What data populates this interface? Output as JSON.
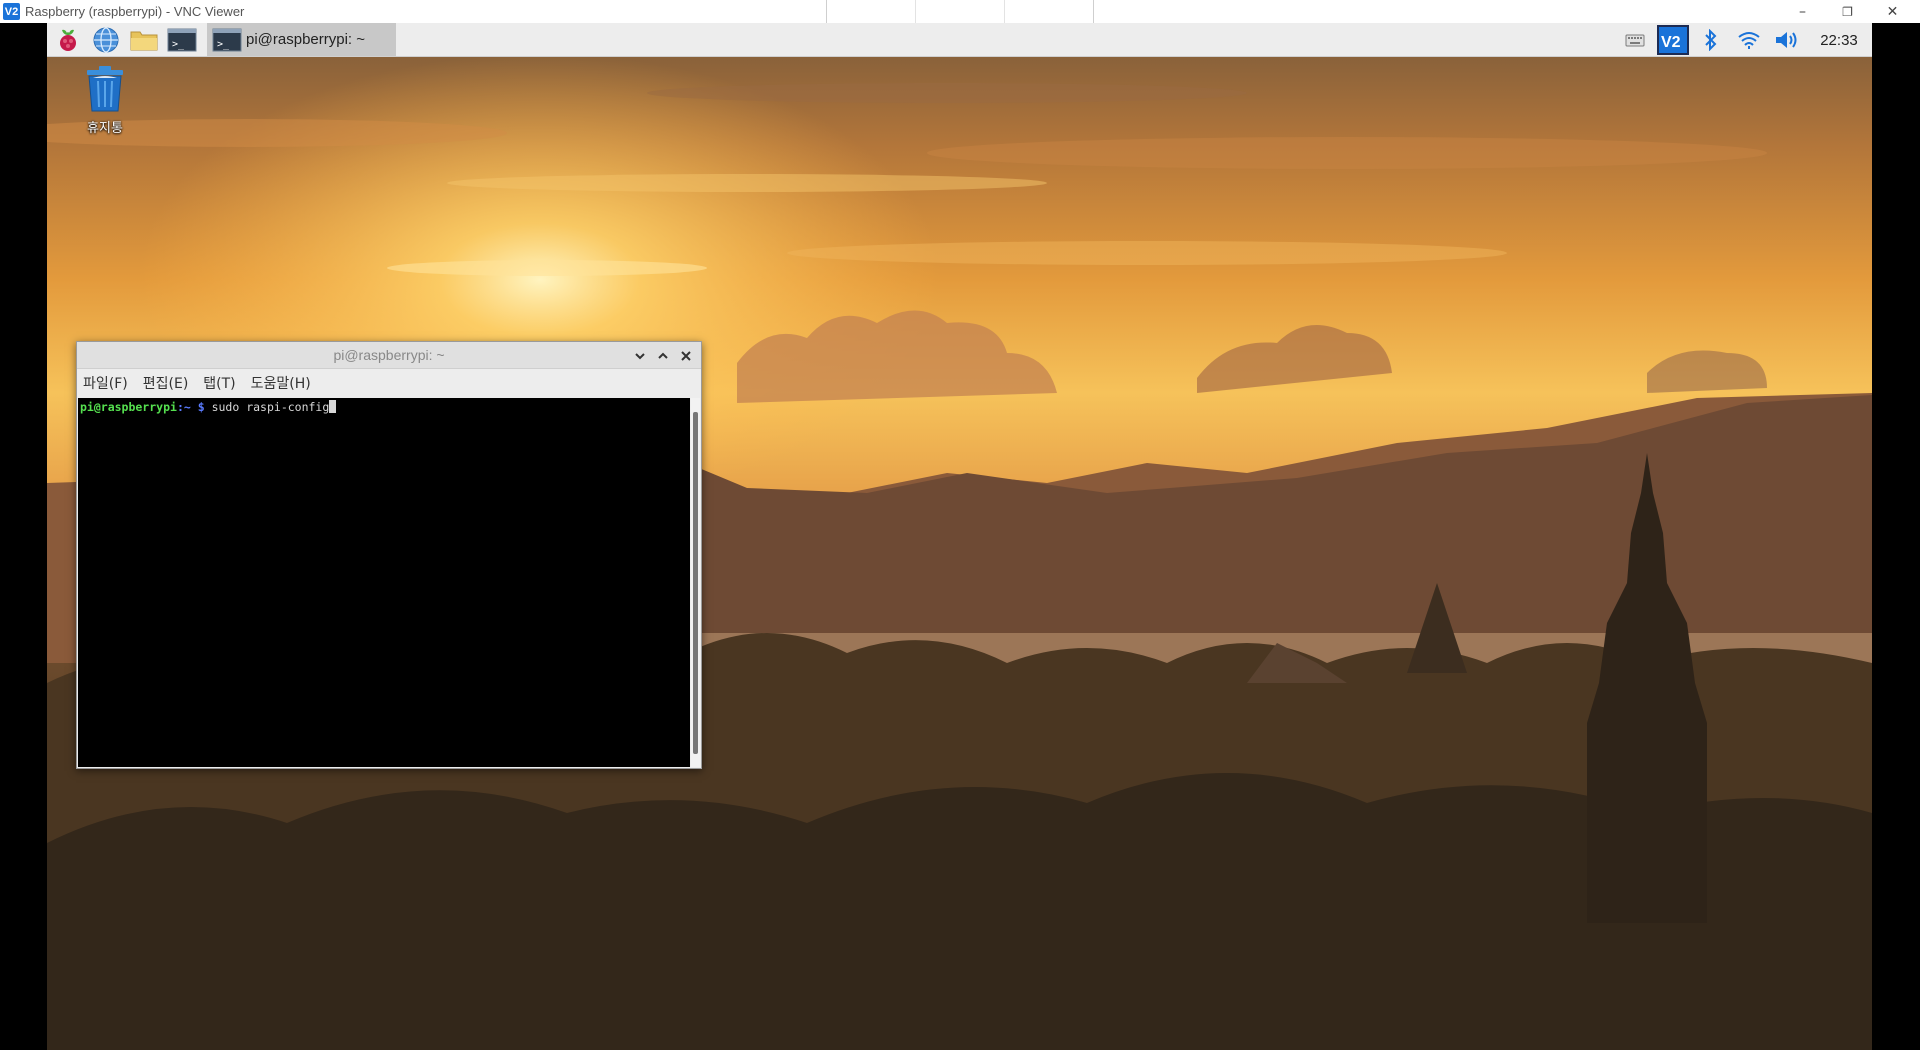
{
  "host": {
    "logo_text": "V2",
    "title": "Raspberry (raspberrypi) - VNC Viewer",
    "minimize": "–",
    "restore": "❐",
    "close": "✕"
  },
  "panel": {
    "launchers": [
      "raspberry-menu-icon",
      "web-browser-icon",
      "file-manager-icon",
      "terminal-icon"
    ],
    "task": {
      "label": "pi@raspberrypi: ~",
      "icon": "terminal-icon"
    },
    "tray": [
      "keyboard-icon",
      "vnc-server-icon",
      "bluetooth-icon",
      "wifi-icon",
      "volume-icon"
    ],
    "clock": "22:33"
  },
  "desktop": {
    "trash_label": "휴지통"
  },
  "terminal": {
    "title": "pi@raspberrypi: ~",
    "menu": [
      "파일(F)",
      "편집(E)",
      "탭(T)",
      "도움말(H)"
    ],
    "prompt_user": "pi@raspberrypi",
    "prompt_path": ":~",
    "prompt_sign": " $",
    "command": " sudo raspi-config"
  },
  "colors": {
    "panel_bg": "#ededed",
    "terminal_bg": "#000000",
    "prompt_green": "#55e04f",
    "prompt_blue": "#5a7bff",
    "vnc_blue": "#1a73d9"
  }
}
